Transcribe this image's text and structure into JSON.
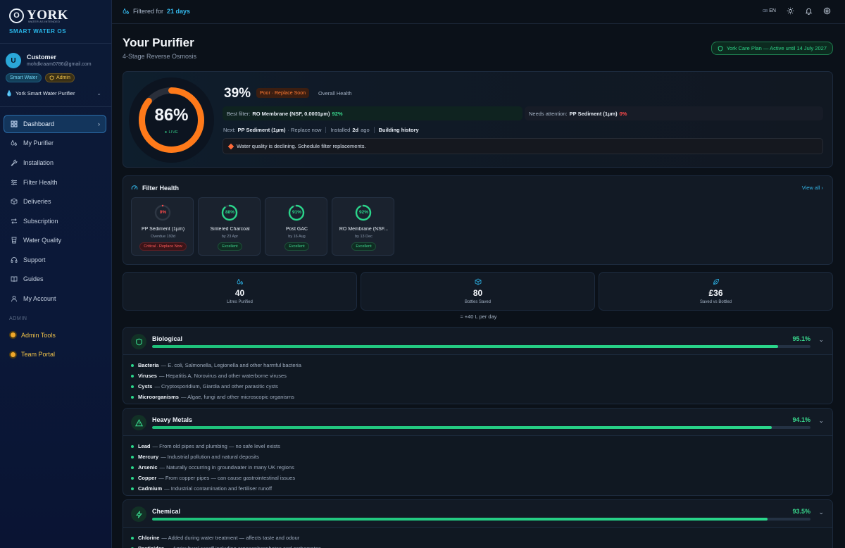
{
  "sidebar": {
    "brand_mark": "O",
    "brand_name": "YORK",
    "brand_tagline": "WATER AS INTENDED",
    "brand_sub": "SMART WATER OS",
    "user": {
      "initial": "U",
      "name": "Customer",
      "email": "mohdkraam0786@gmail.com",
      "badge_smart": "Smart Water",
      "badge_admin": "Admin"
    },
    "device": "York Smart Water Purifier",
    "nav": [
      {
        "label": "Dashboard",
        "icon": "dashboard-icon",
        "active": true
      },
      {
        "label": "My Purifier",
        "icon": "purifier-icon"
      },
      {
        "label": "Installation",
        "icon": "wrench-icon"
      },
      {
        "label": "Filter Health",
        "icon": "sliders-icon"
      },
      {
        "label": "Deliveries",
        "icon": "package-icon"
      },
      {
        "label": "Subscription",
        "icon": "repeat-icon"
      },
      {
        "label": "Water Quality",
        "icon": "glass-icon"
      },
      {
        "label": "Support",
        "icon": "headset-icon"
      },
      {
        "label": "Guides",
        "icon": "book-icon"
      },
      {
        "label": "My Account",
        "icon": "user-icon"
      }
    ],
    "admin_section": "ADMIN",
    "admin_nav": [
      {
        "label": "Admin Tools"
      },
      {
        "label": "Team Portal"
      }
    ]
  },
  "topbar": {
    "filtered_prefix": "Filtered for",
    "filtered_value": "21 days",
    "lang_flag": "GB",
    "lang": "EN"
  },
  "header": {
    "title": "Your Purifier",
    "subtitle": "4-Stage Reverse Osmosis",
    "plan": "York Care Plan — Active until 14 July 2027"
  },
  "health": {
    "ring_value": "86%",
    "ring_fraction": 0.86,
    "ring_live": "● LIVE",
    "overall_pct": "39%",
    "status": "Poor · Replace Soon",
    "overall_label": "Overall Health",
    "best_label": "Best filter:",
    "best_name": "RO Membrane (NSF, 0.0001µm)",
    "best_pct": "92%",
    "need_label": "Needs attention:",
    "need_name": "PP Sediment (1µm)",
    "need_pct": "0%",
    "next_label": "Next:",
    "next_name": "PP Sediment (1µm)",
    "next_suffix": "· Replace now",
    "installed_label": "Installed",
    "installed_value": "2d",
    "installed_suffix": "ago",
    "history": "Building history",
    "warning": "Water quality is declining. Schedule filter replacements."
  },
  "filter_health": {
    "title": "Filter Health",
    "view_all": "View all",
    "filters": [
      {
        "pct": "0%",
        "value": 0,
        "name": "PP Sediment (1µm)",
        "sub": "Overdue 193d",
        "status": "Critical · Replace Now",
        "color": "#ff4b4b",
        "kind": "crit"
      },
      {
        "pct": "88%",
        "value": 0.88,
        "name": "Sintered Charcoal",
        "sub": "by 23 Apr",
        "status": "Excellent",
        "color": "#2ad68b",
        "kind": "exc"
      },
      {
        "pct": "91%",
        "value": 0.91,
        "name": "Post GAC",
        "sub": "by 16 Aug",
        "status": "Excellent",
        "color": "#2ad68b",
        "kind": "exc"
      },
      {
        "pct": "92%",
        "value": 0.92,
        "name": "RO Membrane (NSF...",
        "sub": "by 13 Dec",
        "status": "Excellent",
        "color": "#2ad68b",
        "kind": "exc"
      }
    ]
  },
  "stats": [
    {
      "value": "40",
      "label": "Litres Purified",
      "icon": "drop-icon"
    },
    {
      "value": "80",
      "label": "Bottles Saved",
      "icon": "box-icon"
    },
    {
      "value": "£36",
      "label": "Saved vs Bottled",
      "icon": "leaf-icon"
    }
  ],
  "per_day": "≈ +40 L per day",
  "categories": [
    {
      "name": "Biological",
      "pct": "95.1%",
      "value": 0.951,
      "icon": "shield-icon",
      "items": [
        {
          "term": "Bacteria",
          "desc": "— E. coli, Salmonella, Legionella and other harmful bacteria"
        },
        {
          "term": "Viruses",
          "desc": "— Hepatitis A, Norovirus and other waterborne viruses"
        },
        {
          "term": "Cysts",
          "desc": "— Cryptosporidium, Giardia and other parasitic cysts"
        },
        {
          "term": "Microorganisms",
          "desc": "— Algae, fungi and other microscopic organisms"
        }
      ]
    },
    {
      "name": "Heavy Metals",
      "pct": "94.1%",
      "value": 0.941,
      "icon": "warning-icon",
      "items": [
        {
          "term": "Lead",
          "desc": "— From old pipes and plumbing — no safe level exists"
        },
        {
          "term": "Mercury",
          "desc": "— Industrial pollution and natural deposits"
        },
        {
          "term": "Arsenic",
          "desc": "— Naturally occurring in groundwater in many UK regions"
        },
        {
          "term": "Copper",
          "desc": "— From copper pipes — can cause gastrointestinal issues"
        },
        {
          "term": "Cadmium",
          "desc": "— Industrial contamination and fertiliser runoff"
        }
      ]
    },
    {
      "name": "Chemical",
      "pct": "93.5%",
      "value": 0.935,
      "icon": "bolt-icon",
      "items": [
        {
          "term": "Chlorine",
          "desc": "— Added during water treatment — affects taste and odour"
        },
        {
          "term": "Pesticides",
          "desc": "— Agricultural runoff including organophosphates and carbamates"
        }
      ]
    }
  ]
}
